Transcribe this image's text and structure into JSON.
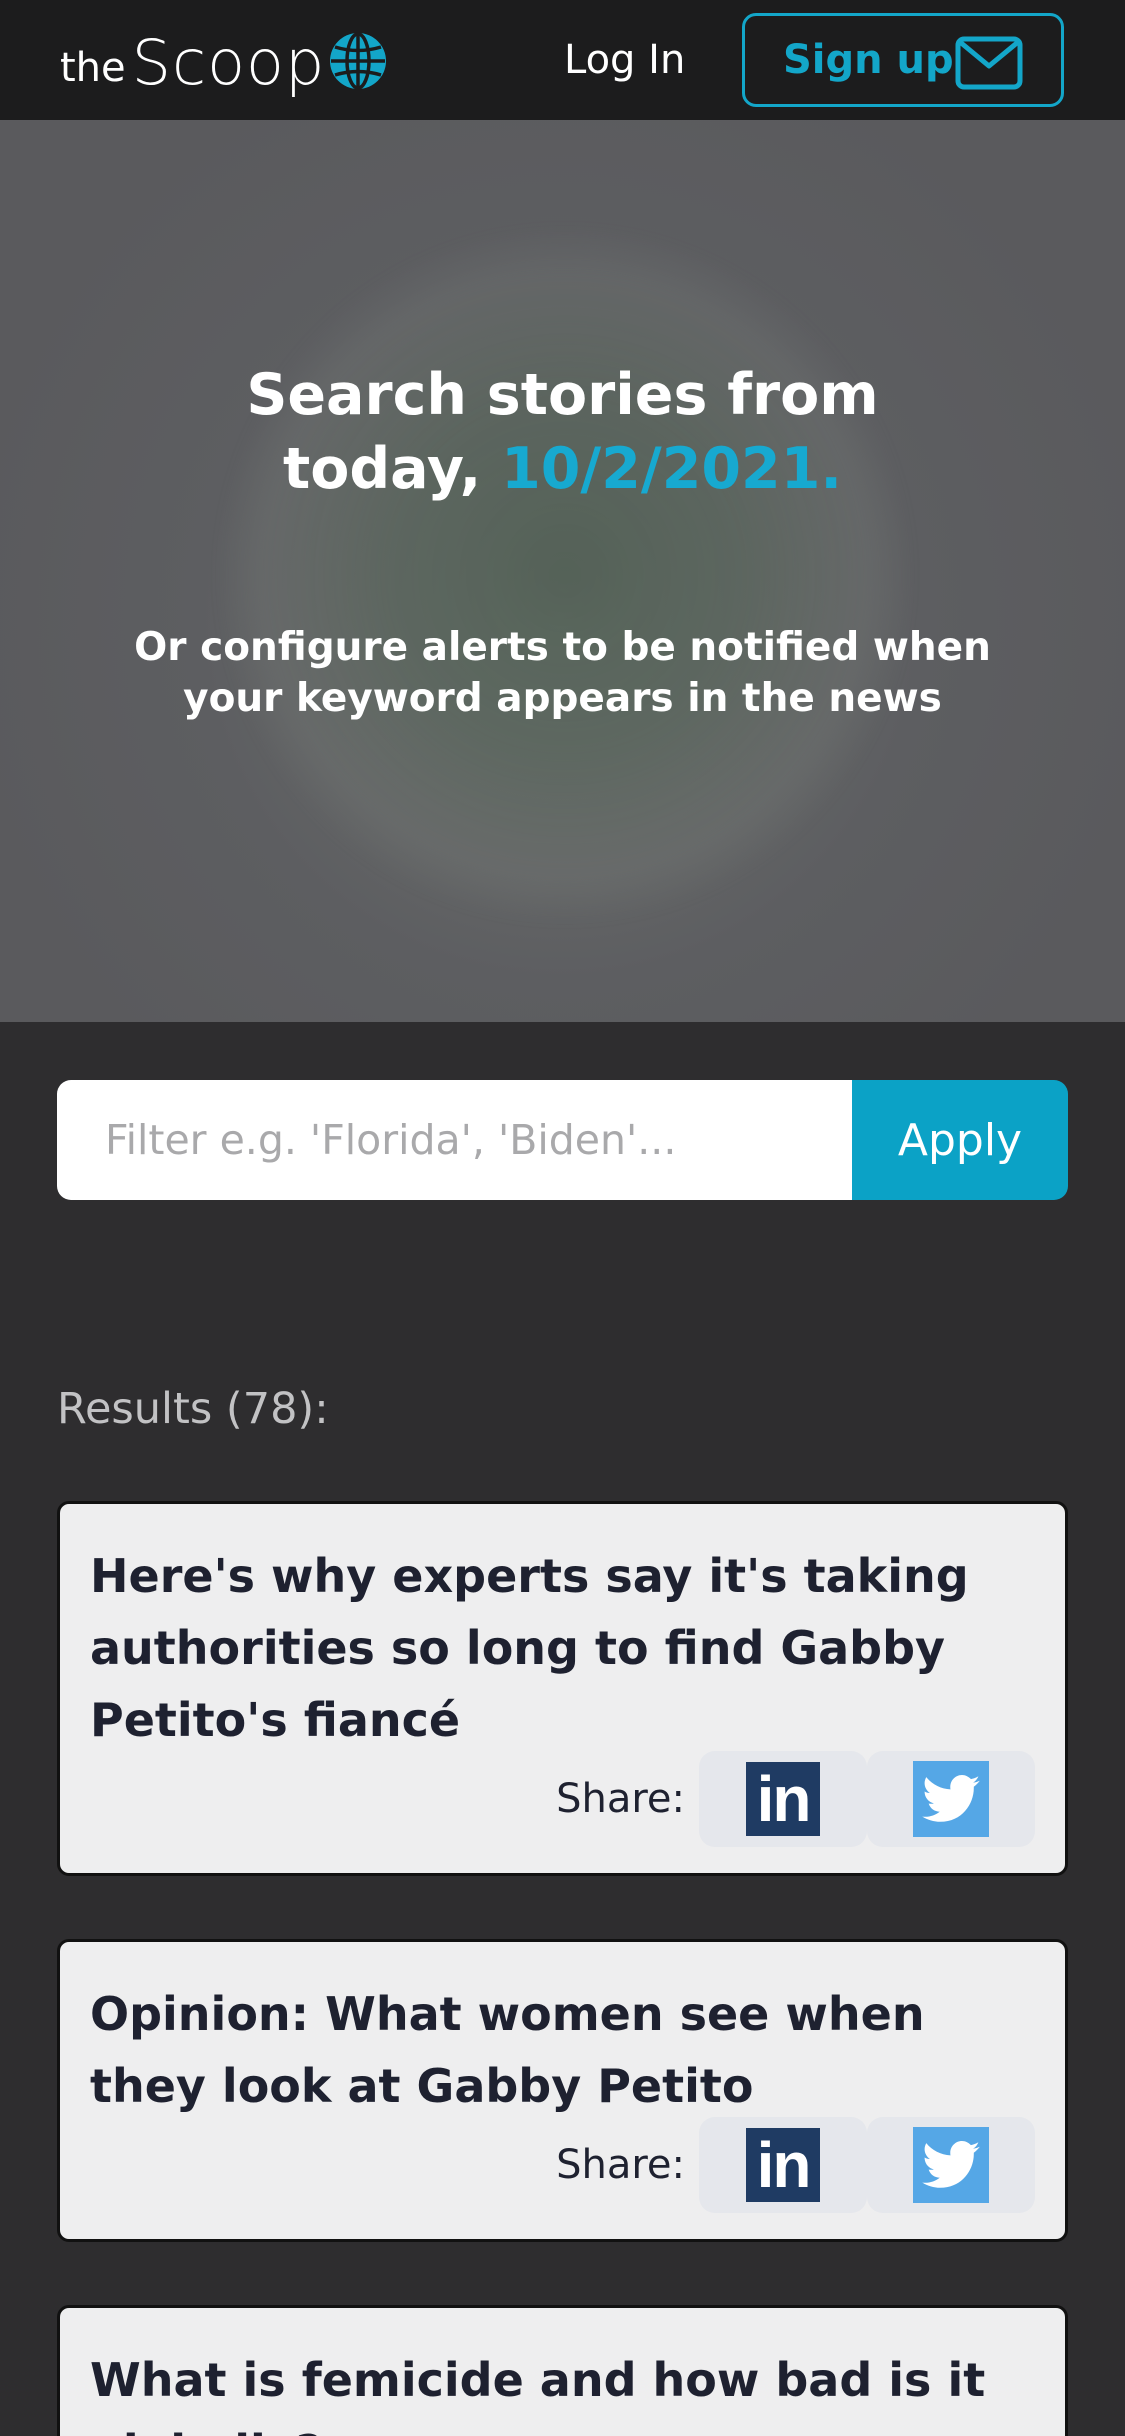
{
  "header": {
    "logo_the": "the",
    "logo_scoop": "Scoop",
    "login_label": "Log In",
    "signup_label": "Sign up"
  },
  "hero": {
    "title_line1": "Search stories from",
    "title_line2_prefix": "today, ",
    "date": "10/2/2021.",
    "subtitle": "Or configure alerts to be notified when your keyword appears in the news"
  },
  "search": {
    "placeholder": "Filter e.g. 'Florida', 'Biden'...",
    "value": "",
    "apply_label": "Apply"
  },
  "results": {
    "label": "Results (78):",
    "share_label": "Share:",
    "items": [
      {
        "title": "Here's why experts say it's taking authorities so long to find Gabby Petito's fiancé"
      },
      {
        "title": "Opinion: What women see when they look at Gabby Petito"
      },
      {
        "title": "What is femicide and how bad is it globally?"
      }
    ]
  },
  "icons": {
    "linkedin": "linkedin-icon",
    "twitter": "twitter-icon",
    "envelope": "envelope-icon",
    "globe": "globe-icon"
  },
  "colors": {
    "accent": "#13a6c9",
    "header_bg": "#1c1c1d",
    "page_bg": "#2e2d2f",
    "card_bg": "#eeeeef",
    "linkedin": "#1f3b63",
    "twitter": "#55a7e6"
  }
}
